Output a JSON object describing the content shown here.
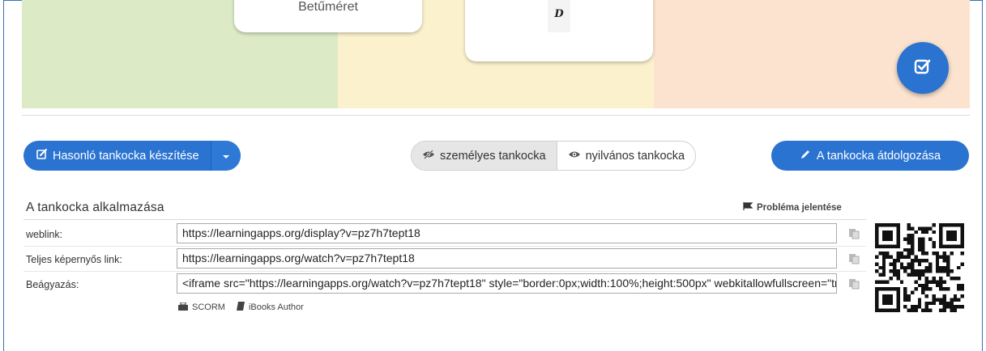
{
  "banner": {
    "card1_title": "Betűméret",
    "card2_glyph": "D"
  },
  "toolbar": {
    "create_similar_label": "Hasonló tankocka készítése",
    "private_label": "személyes tankocka",
    "public_label": "nyilvános tankocka",
    "edit_label": "A tankocka átdolgozása"
  },
  "embed": {
    "section_title": "A tankocka alkalmazása",
    "report_label": "Probléma jelentése",
    "rows": [
      {
        "label": "weblink:",
        "value": "https://learningapps.org/display?v=pz7h7tept18"
      },
      {
        "label": "Teljes képernyős link:",
        "value": "https://learningapps.org/watch?v=pz7h7tept18"
      },
      {
        "label": "Beágyazás:",
        "value": "<iframe src=\"https://learningapps.org/watch?v=pz7h7tept18\" style=\"border:0px;width:100%;height:500px\" webkitallowfullscreen=\"true\" mozallowfullscreen=\"true\"></iframe>"
      }
    ],
    "exports": {
      "scorm": "SCORM",
      "ibooks": "iBooks Author"
    }
  },
  "colors": {
    "accent": "#2a73d1",
    "band_green": "#dcebc6",
    "band_yellow": "#fbf2cd",
    "band_orange": "#fce3d0"
  },
  "icons": {
    "create_similar": "edit-square-icon",
    "dropdown": "caret-down-icon",
    "private": "eye-slash-icon",
    "public": "eye-icon",
    "edit": "pencil-icon",
    "report": "flag-icon",
    "copy": "clipboard-icon",
    "scorm": "package-icon",
    "ibooks": "book-icon",
    "fab": "check-square-icon",
    "qr": "qr-code-icon"
  }
}
